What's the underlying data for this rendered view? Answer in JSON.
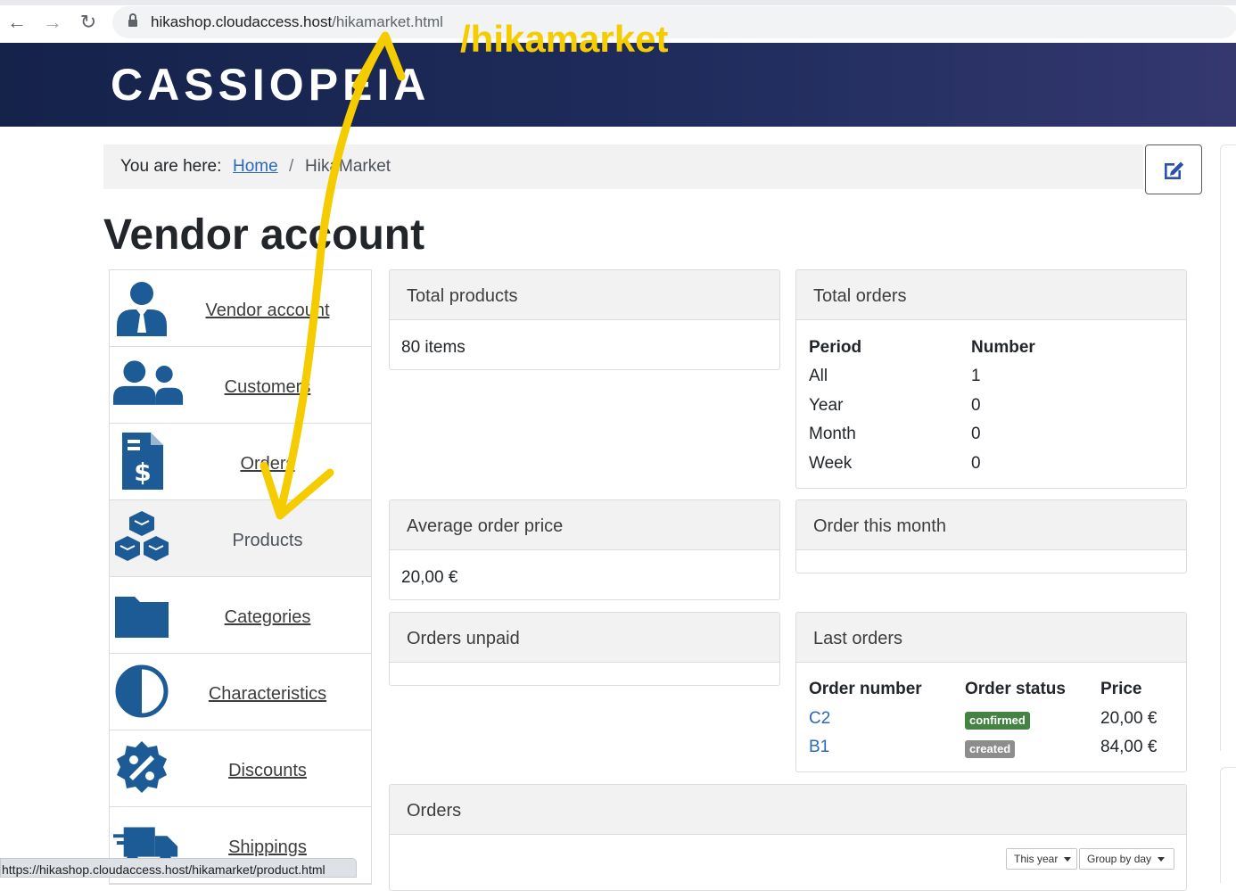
{
  "browser": {
    "url_host": "hikashop.cloudaccess.host",
    "url_path": "/hikamarket.html",
    "status_url": "https://hikashop.cloudaccess.host/hikamarket/product.html"
  },
  "header": {
    "brand": "CASSIOPEIA"
  },
  "breadcrumb": {
    "prefix": "You are here:",
    "home": "Home",
    "separator": "/",
    "current": "HikaMarket"
  },
  "page": {
    "title": "Vendor account"
  },
  "menu": {
    "items": [
      {
        "label": "Vendor account",
        "icon": "vendor-user-icon"
      },
      {
        "label": "Customers",
        "icon": "customers-icon"
      },
      {
        "label": "Orders",
        "icon": "invoice-dollar-icon"
      },
      {
        "label": "Products",
        "icon": "cubes-icon",
        "active": true
      },
      {
        "label": "Categories",
        "icon": "folder-icon"
      },
      {
        "label": "Characteristics",
        "icon": "half-circle-icon"
      },
      {
        "label": "Discounts",
        "icon": "percent-badge-icon"
      },
      {
        "label": "Shippings",
        "icon": "truck-icon"
      }
    ]
  },
  "cards": {
    "total_products": {
      "title": "Total products",
      "value": "80 items"
    },
    "total_orders": {
      "title": "Total orders",
      "col_period": "Period",
      "col_number": "Number",
      "rows": [
        {
          "period": "All",
          "number": "1"
        },
        {
          "period": "Year",
          "number": "0"
        },
        {
          "period": "Month",
          "number": "0"
        },
        {
          "period": "Week",
          "number": "0"
        }
      ]
    },
    "average_price": {
      "title": "Average order price",
      "value": "20,00 €"
    },
    "order_month": {
      "title": "Order this month"
    },
    "orders_unpaid": {
      "title": "Orders unpaid"
    },
    "last_orders": {
      "title": "Last orders",
      "col_number": "Order number",
      "col_status": "Order status",
      "col_price": "Price",
      "rows": [
        {
          "number": "C2",
          "status": "confirmed",
          "price": "20,00 €"
        },
        {
          "number": "B1",
          "status": "created",
          "price": "84,00 €"
        }
      ]
    },
    "orders": {
      "title": "Orders",
      "period_select": "This year",
      "group_select": "Group by day"
    }
  },
  "annotation": {
    "text": "/hikamarket",
    "color": "#f5cc00"
  },
  "colors": {
    "accent": "#1d5b97",
    "link": "#2a69b8",
    "confirmed": "#448344",
    "created": "#8d8d8d"
  }
}
